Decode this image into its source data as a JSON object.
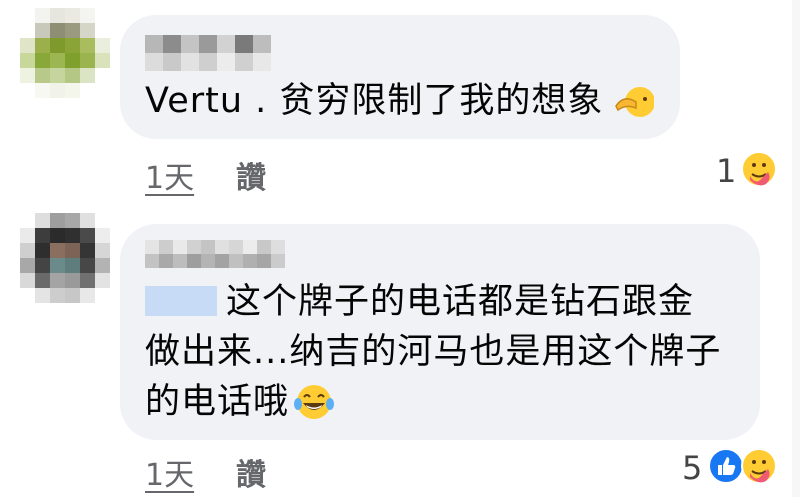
{
  "comments": [
    {
      "text": "Vertu . 贫穷限制了我的想象",
      "emoji": "pointing-finger-face-emoji",
      "time": "1天",
      "like_label": "讚",
      "reaction_count": "1",
      "reactions": [
        "care-reaction-icon"
      ]
    },
    {
      "mention_blurred": true,
      "line1": "这个牌子的电话都是钻石跟金",
      "line2": "做出来...纳吉的河马也是用这个牌子",
      "line3": "的电话哦",
      "emoji": "tears-of-joy-emoji",
      "time": "1天",
      "like_label": "讚",
      "reaction_count": "5",
      "reactions": [
        "like-reaction-icon",
        "care-reaction-icon"
      ]
    }
  ],
  "colors": {
    "bubble": "#f0f2f5",
    "meta": "#65676b",
    "like_blue": "#1877f2",
    "emoji_yellow": "#ffcc33"
  }
}
